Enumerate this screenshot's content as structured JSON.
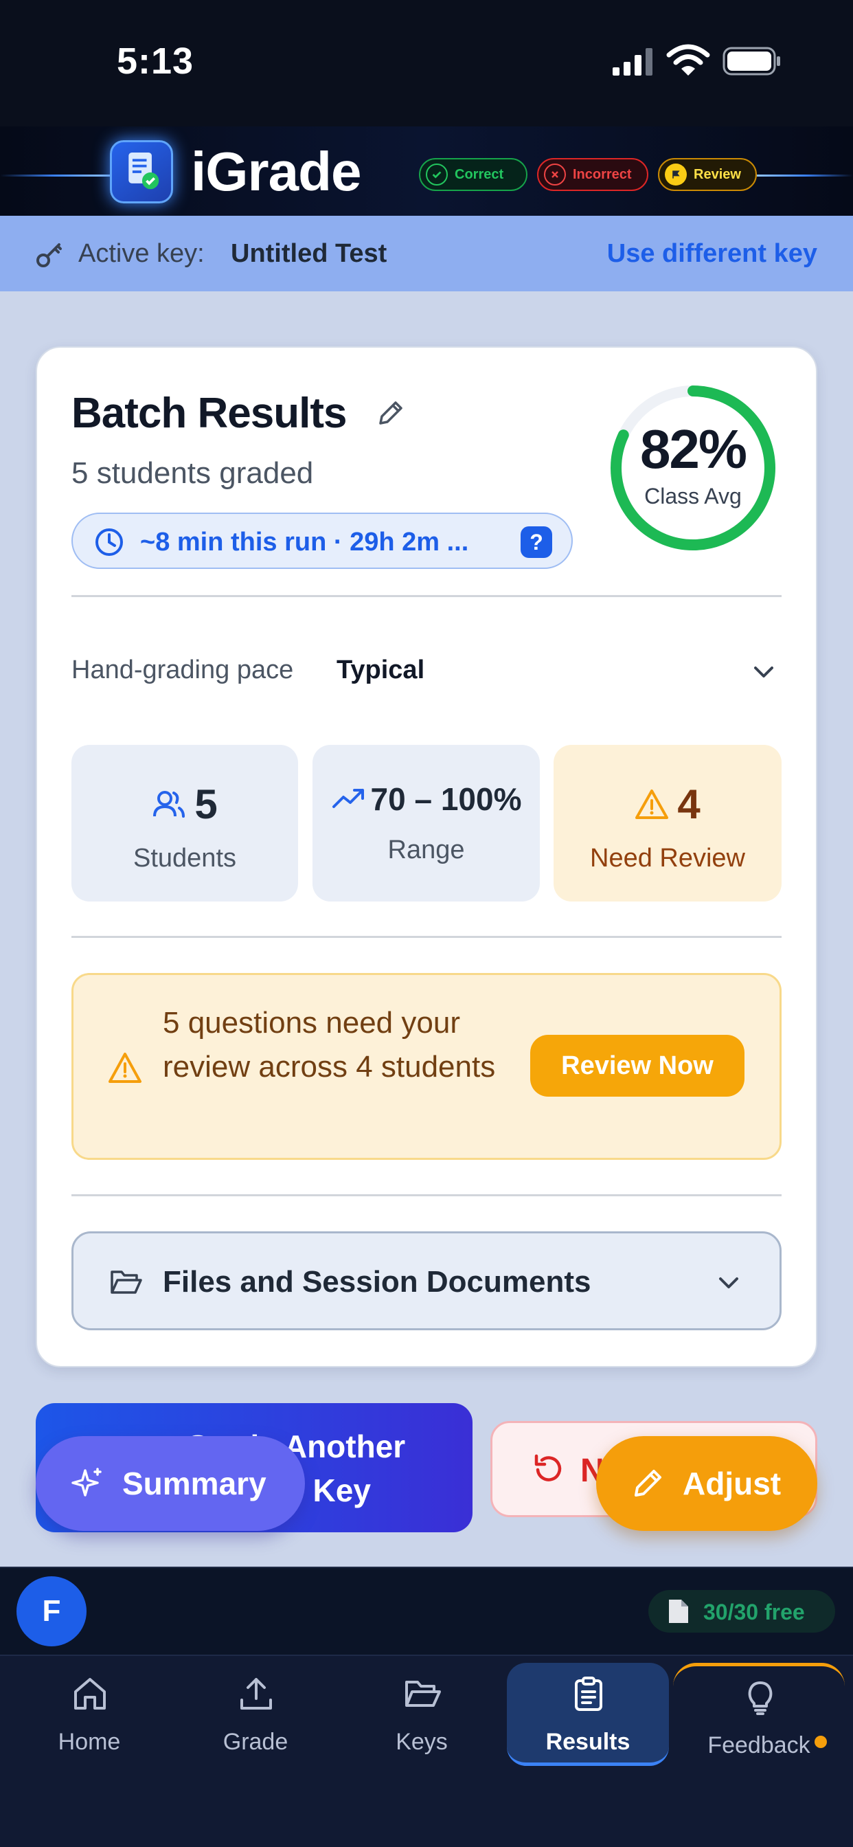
{
  "status_bar": {
    "time": "5:13"
  },
  "header": {
    "brand": "iGrade",
    "legend": [
      {
        "label": "Correct",
        "color": "#22c55e"
      },
      {
        "label": "Incorrect",
        "color": "#ef4444"
      },
      {
        "label": "Review",
        "color": "#facc15"
      }
    ]
  },
  "key_bar": {
    "label": "Active key:",
    "value": "Untitled Test",
    "link": "Use different key"
  },
  "results": {
    "title": "Batch Results",
    "subtitle": "5 students graded",
    "time_pill": "~8 min this run · 29h 2m ...",
    "help": "?",
    "class_avg_value": "82%",
    "class_avg_fraction": 0.82,
    "class_avg_label": "Class Avg",
    "pace_label": "Hand-grading pace",
    "pace_value": "Typical",
    "stats": [
      {
        "value": "5",
        "label": "Students"
      },
      {
        "value": "70 – 100%",
        "label": "Range"
      },
      {
        "value": "4",
        "label": "Need Review"
      }
    ],
    "review_alert": {
      "message": "5 questions need your review across 4 students",
      "button": "Review Now"
    },
    "files_label": "Files and Session Documents"
  },
  "actions": {
    "grade_another_line1": "Grade Another",
    "grade_another_line2": "Same Key",
    "new_label": "N",
    "summary": "Summary",
    "adjust": "Adjust"
  },
  "user": {
    "avatar_letter": "F",
    "quota": "30/30 free"
  },
  "tabs": [
    {
      "label": "Home",
      "icon": "home-icon"
    },
    {
      "label": "Grade",
      "icon": "upload-icon"
    },
    {
      "label": "Keys",
      "icon": "folder-icon"
    },
    {
      "label": "Results",
      "icon": "clipboard-icon",
      "active": true
    },
    {
      "label": "Feedback",
      "icon": "lightbulb-icon"
    }
  ]
}
